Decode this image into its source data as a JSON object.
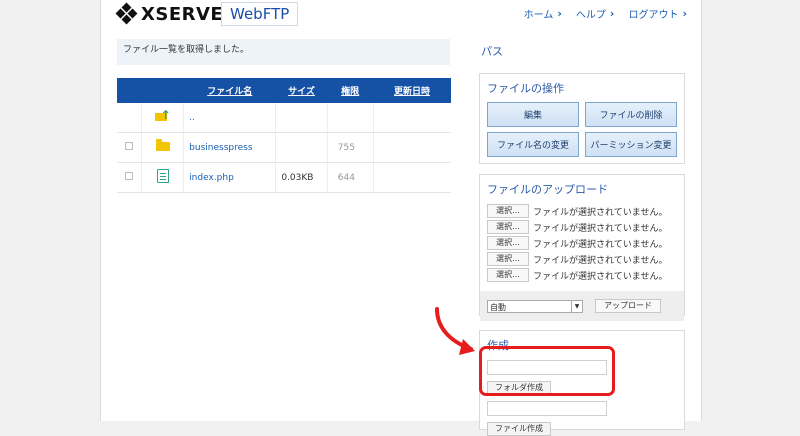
{
  "header": {
    "logo": "XSERVER",
    "product": "WebFTP",
    "nav": [
      {
        "label": "ホーム"
      },
      {
        "label": "ヘルプ"
      },
      {
        "label": "ログアウト"
      }
    ]
  },
  "status_message": "ファイル一覧を取得しました。",
  "file_table": {
    "headers": [
      "ファイル名",
      "サイズ",
      "権限",
      "更新日時"
    ],
    "rows": [
      {
        "name": "..",
        "size": "",
        "permission": "",
        "icon": "parent-folder-icon"
      },
      {
        "name": "businesspress",
        "size": "",
        "permission": "755",
        "icon": "folder-icon"
      },
      {
        "name": "index.php",
        "size": "0.03KB",
        "permission": "644",
        "icon": "file-icon"
      }
    ]
  },
  "right": {
    "path_title": "パス",
    "operations": {
      "title": "ファイルの操作",
      "buttons": [
        "編集",
        "ファイルの削除",
        "ファイル名の変更",
        "パーミッション変更"
      ]
    },
    "upload": {
      "title": "ファイルのアップロード",
      "pick_label": "選択...",
      "empty_text": "ファイルが選択されていません。",
      "row_count": 5,
      "mode_selected": "自動",
      "upload_button": "アップロード"
    },
    "create": {
      "title": "作成",
      "folder_button": "フォルダ作成",
      "file_button": "ファイル作成"
    }
  },
  "colors": {
    "accent": "#1552a6",
    "highlight": "#e51d1d"
  }
}
